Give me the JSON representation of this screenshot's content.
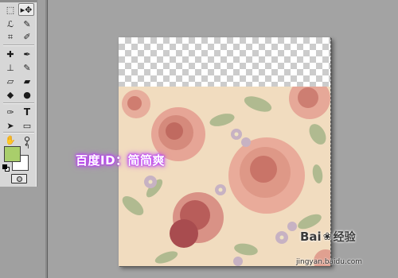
{
  "toolbar": {
    "tools": [
      {
        "name": "move-tool-icon",
        "glyph": "▸✥"
      },
      {
        "name": "marquee-tool-icon",
        "glyph": "⬚"
      },
      {
        "name": "lasso-tool-icon",
        "glyph": "ℒ"
      },
      {
        "name": "quick-select-tool-icon",
        "glyph": "✎"
      },
      {
        "name": "crop-tool-icon",
        "glyph": "⌗"
      },
      {
        "name": "eyedropper-tool-icon",
        "glyph": "✐"
      },
      {
        "name": "healing-brush-tool-icon",
        "glyph": "✚"
      },
      {
        "name": "brush-tool-icon",
        "glyph": "✒"
      },
      {
        "name": "stamp-tool-icon",
        "glyph": "⊥"
      },
      {
        "name": "history-brush-tool-icon",
        "glyph": "✎"
      },
      {
        "name": "eraser-tool-icon",
        "glyph": "▱"
      },
      {
        "name": "gradient-tool-icon",
        "glyph": "▰"
      },
      {
        "name": "blur-tool-icon",
        "glyph": "◆"
      },
      {
        "name": "dodge-tool-icon",
        "glyph": "●"
      },
      {
        "name": "pen-tool-icon",
        "glyph": "✑"
      },
      {
        "name": "type-tool-icon",
        "glyph": "T"
      },
      {
        "name": "path-select-tool-icon",
        "glyph": "➤"
      },
      {
        "name": "shape-tool-icon",
        "glyph": "▭"
      },
      {
        "name": "3d-rotate-tool-icon",
        "glyph": "⊛"
      },
      {
        "name": "3d-orbit-tool-icon",
        "glyph": "⟲"
      },
      {
        "name": "hand-tool-icon",
        "glyph": "✋"
      },
      {
        "name": "zoom-tool-icon",
        "glyph": "⚲"
      }
    ],
    "swap_glyph": "↰",
    "foreground_color": "#a9ce6b",
    "background_color": "#ffffff"
  },
  "canvas": {
    "transparency_color_a": "#ffffff",
    "transparency_color_b": "#cccccc",
    "floral_background": "#f1dcbf"
  },
  "watermarks": {
    "id_text": "百度ID：简简爽",
    "brand_text": "Bai",
    "paw_glyph": "❀",
    "jingyan_text": "经验",
    "url_text": "jingyan.baidu.com"
  }
}
